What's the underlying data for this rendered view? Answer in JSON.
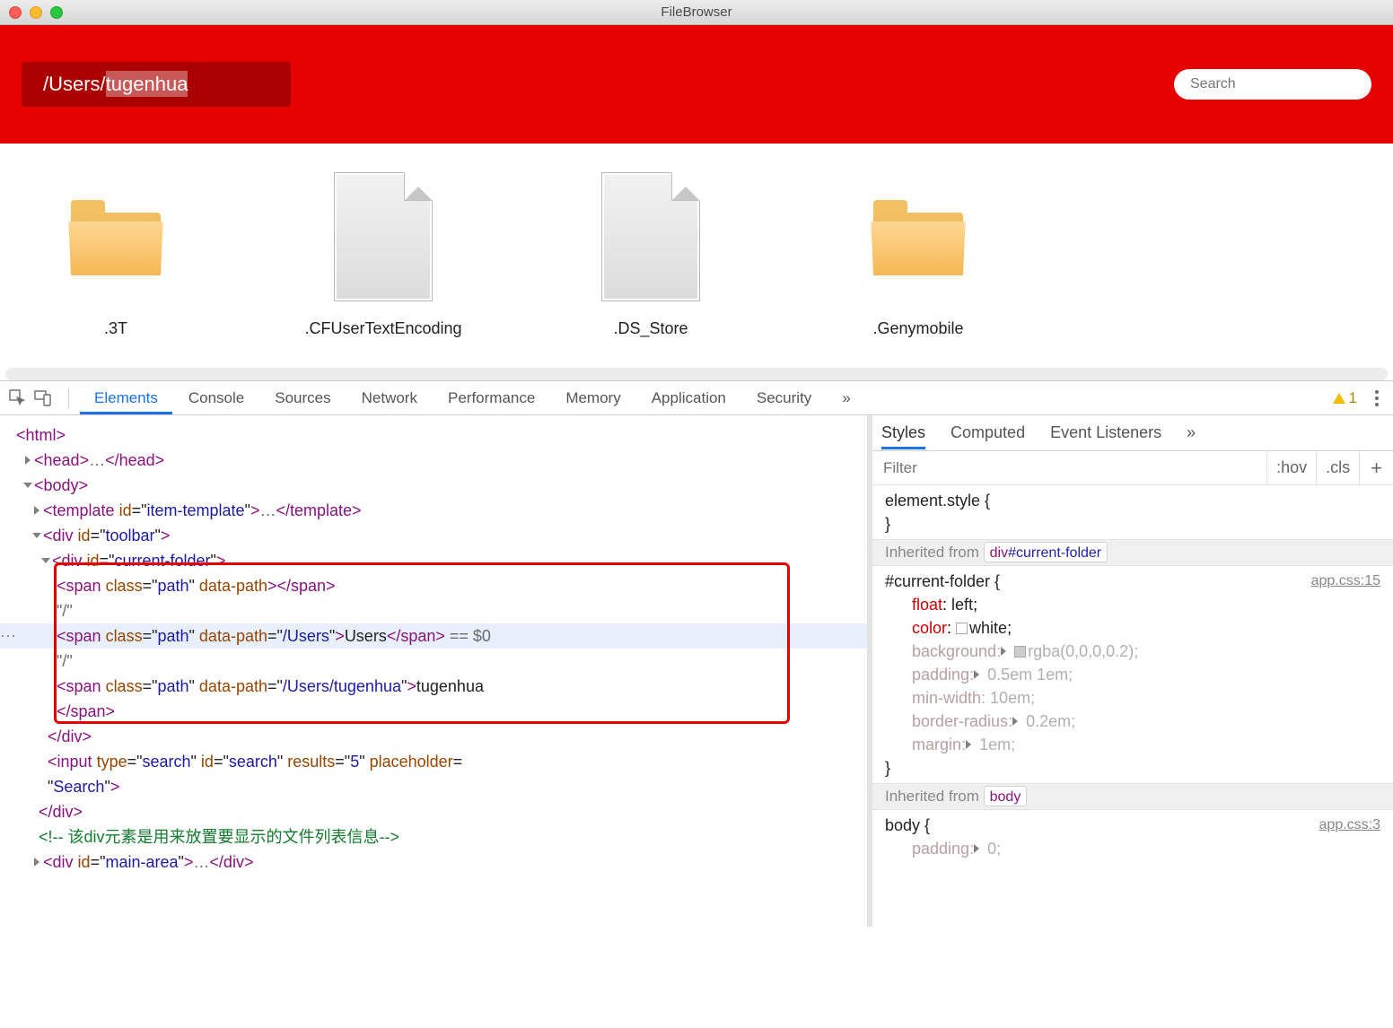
{
  "window": {
    "title": "FileBrowser"
  },
  "toolbar": {
    "path_prefix": "/Users/",
    "path_selected": "tugenhua",
    "search_placeholder": "Search"
  },
  "items": [
    {
      "name": ".3T",
      "kind": "folder"
    },
    {
      "name": ".CFUserTextEncoding",
      "kind": "file"
    },
    {
      "name": ".DS_Store",
      "kind": "file"
    },
    {
      "name": ".Genymobile",
      "kind": "folder"
    }
  ],
  "devtools": {
    "tabs": [
      "Elements",
      "Console",
      "Sources",
      "Network",
      "Performance",
      "Memory",
      "Application",
      "Security"
    ],
    "active_tab": "Elements",
    "warn_count": "1",
    "styles_tabs": [
      "Styles",
      "Computed",
      "Event Listeners"
    ],
    "styles_active": "Styles",
    "filter_placeholder": "Filter",
    "hov": ":hov",
    "cls": ".cls",
    "elementStyleOpen": "element.style {",
    "brace_close": "}",
    "inherit_label": "Inherited from",
    "link1": "app.css:15",
    "link2": "app.css:3",
    "currentFolderSelector": "#current-folder {",
    "props": [
      {
        "n": "float",
        "v": "left",
        "dim": false
      },
      {
        "n": "color",
        "v": "white",
        "dim": false,
        "swatch": "#ffffff"
      },
      {
        "n": "background",
        "v": "rgba(0,0,0,0.2)",
        "dim": true,
        "exp": true,
        "swatch": "rgba(0,0,0,0.2)"
      },
      {
        "n": "padding",
        "v": "0.5em 1em",
        "dim": true,
        "exp": true
      },
      {
        "n": "min-width",
        "v": "10em",
        "dim": true
      },
      {
        "n": "border-radius",
        "v": "0.2em",
        "dim": true,
        "exp": true
      },
      {
        "n": "margin",
        "v": "1em",
        "dim": true,
        "exp": true
      }
    ],
    "bodySelector": "body {",
    "bodyPropN": "padding",
    "bodyPropV": "0",
    "selector_badge1": {
      "tag": "div",
      "id": "#current-folder"
    },
    "selector_badge2": {
      "tag": "body"
    },
    "dom_lines": {
      "l1": "<html>",
      "l2_a": "<head>",
      "l2_b": "…",
      "l2_c": "</head>",
      "l3": "<body>",
      "l4_a": "<template id=\"item-template\">",
      "l4_b": "…",
      "l4_c": "</template>",
      "l5": "<div id=\"toolbar\">",
      "l6": "<div id=\"current-folder\">",
      "l7_a": "<span class=\"path\" data-path>",
      "l7_b": "</span>",
      "l8": "\"/\"",
      "l9_a": "<span class=\"path\" data-path=\"/Users\">",
      "l9_b": "Users",
      "l9_c": "</span>",
      "l9_d": " == $0",
      "l10": "\"/\"",
      "l11_a": "<span class=\"path\" data-path=\"/Users/tugenhua\">",
      "l11_b": "tugenhua",
      "l12": "</span>",
      "l13": "</div>",
      "l14": "<input type=\"search\" id=\"search\" results=\"5\" placeholder=\"Search\">",
      "l15": "</div>",
      "l16": "<!-- 该div元素是用来放置要显示的文件列表信息-->",
      "l17_a": "<div id=\"main-area\">",
      "l17_b": "…",
      "l17_c": "</div>"
    }
  }
}
